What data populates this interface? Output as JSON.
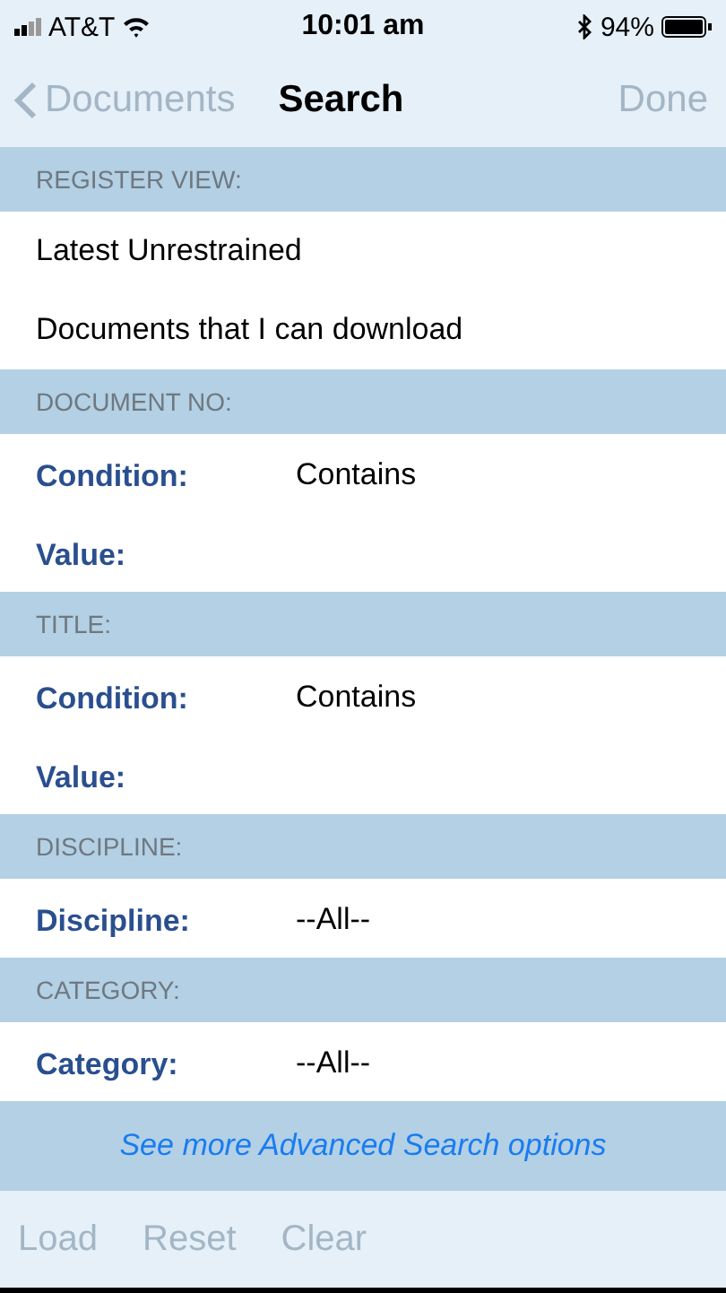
{
  "status_bar": {
    "carrier": "AT&T",
    "time": "10:01 am",
    "battery": "94%"
  },
  "nav": {
    "back": {
      "label": "Documents",
      "disabled": true
    },
    "title": "Search",
    "done": {
      "label": "Done",
      "disabled": true
    }
  },
  "sections": [
    {
      "header": "REGISTER VIEW:",
      "rows": [
        {
          "kind": "option",
          "text": "Latest Unrestrained"
        },
        {
          "kind": "option",
          "text": "Documents that I can download"
        }
      ]
    },
    {
      "header": "DOCUMENT NO:",
      "rows": [
        {
          "kind": "field",
          "label": "Condition:",
          "value": "Contains"
        },
        {
          "kind": "field",
          "label": "Value:"
        }
      ]
    },
    {
      "header": "TITLE:",
      "rows": [
        {
          "kind": "field",
          "label": "Condition:",
          "value": "Contains"
        },
        {
          "kind": "field",
          "label": "Value:"
        }
      ]
    },
    {
      "header": "DISCIPLINE:",
      "rows": [
        {
          "kind": "field",
          "label": "Discipline:",
          "value": "--All--"
        }
      ]
    },
    {
      "header": "CATEGORY:",
      "rows": [
        {
          "kind": "field",
          "label": "Category:",
          "value": "--All--"
        }
      ]
    }
  ],
  "advanced_link": "See more Advanced Search options",
  "toolbar": [
    {
      "label": "Load",
      "disabled": true
    },
    {
      "label": "Reset",
      "disabled": true
    },
    {
      "label": "Clear",
      "disabled": true
    }
  ]
}
